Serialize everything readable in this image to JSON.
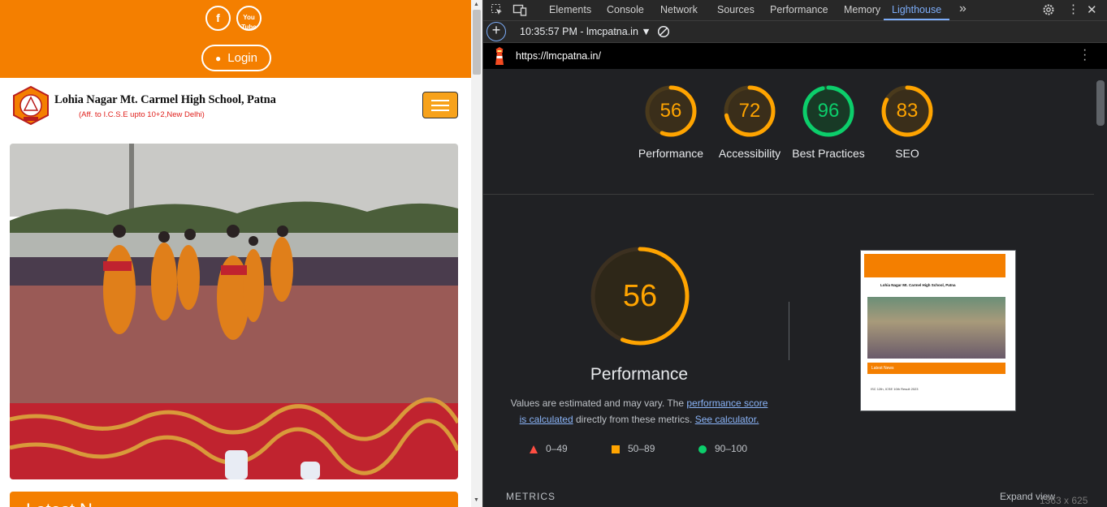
{
  "website": {
    "login_label": "Login",
    "school_name": "Lohia Nagar Mt. Carmel High School, Patna",
    "affiliation": "(Aff. to I.C.S.E upto 10+2,New Delhi)",
    "latest_news_label": "Latest N",
    "social": [
      "facebook-icon",
      "youtube-icon"
    ],
    "youtube_text": "You Tube",
    "colors": {
      "brand_orange": "#f47f00",
      "menu_button": "#f7a21b"
    }
  },
  "devtools": {
    "tabs": [
      "Elements",
      "Console",
      "Network",
      "Sources",
      "Performance",
      "Memory",
      "Lighthouse"
    ],
    "active_tab": "Lighthouse",
    "session_label": "10:35:57 PM - lmcpatna.in",
    "url": "https://lmcpatna.in/",
    "scores": [
      {
        "value": "56",
        "label": "Performance",
        "color": "#ffa400"
      },
      {
        "value": "72",
        "label": "Accessibility",
        "color": "#ffa400"
      },
      {
        "value": "96",
        "label": "Best Practices",
        "color": "#0cce6b"
      },
      {
        "value": "83",
        "label": "SEO",
        "color": "#ffa400"
      }
    ],
    "performance": {
      "score": "56",
      "title": "Performance",
      "desc_prefix": "Values are estimated and may vary. The ",
      "desc_link1": "performance score is calculated",
      "desc_mid": " directly from these metrics. ",
      "desc_link2": "See calculator."
    },
    "legend": [
      {
        "range": "0–49",
        "shape": "triangle",
        "color": "#ff4e42"
      },
      {
        "range": "50–89",
        "shape": "square",
        "color": "#ffa400"
      },
      {
        "range": "90–100",
        "shape": "circle",
        "color": "#0cce6b"
      }
    ],
    "thumbnail": {
      "login": "Login",
      "school_name": "Lohia Nagar Mt. Carmel High School, Patna",
      "news_label": "Latest News",
      "news_item": "ISC 12th, ICSE 10th Result 2023"
    },
    "metrics_label": "METRICS",
    "expand_label": "Expand view",
    "dimensions": "1363 x 625"
  }
}
